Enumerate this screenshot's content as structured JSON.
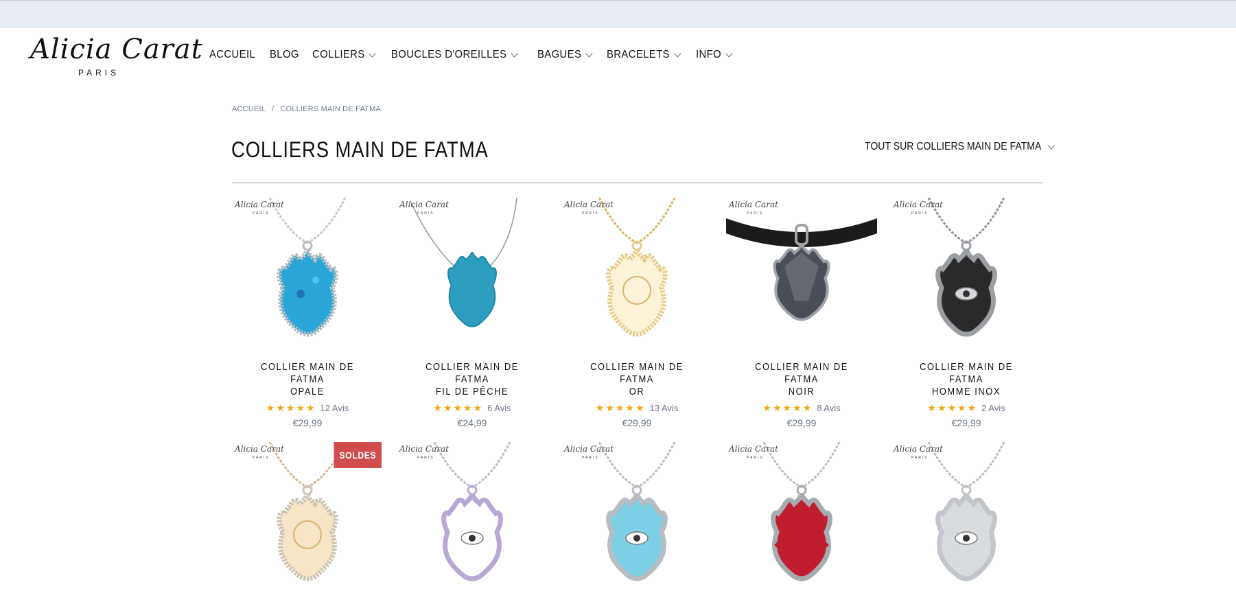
{
  "brand": {
    "name": "Alicia Carat",
    "city": "PARIS"
  },
  "nav": [
    {
      "label": "ACCUEIL",
      "has_dropdown": false
    },
    {
      "label": "BLOG",
      "has_dropdown": false
    },
    {
      "label": "COLLIERS",
      "has_dropdown": true
    },
    {
      "label": "BOUCLES D'OREILLES",
      "has_dropdown": true
    },
    {
      "label": "BAGUES",
      "has_dropdown": true
    },
    {
      "label": "BRACELETS",
      "has_dropdown": true
    },
    {
      "label": "INFO",
      "has_dropdown": true
    }
  ],
  "breadcrumb": {
    "home": "ACCUEIL",
    "separator": "/",
    "current": "COLLIERS MAIN DE FATMA"
  },
  "page": {
    "title": "COLLIERS MAIN DE FATMA",
    "sort_label": "TOUT SUR COLLIERS MAIN DE FATMA"
  },
  "products": [
    {
      "title_line1": "COLLIER MAIN DE FATMA",
      "title_line2": "OPALE",
      "rating": "★★★★★",
      "reviews": "12 Avis",
      "price": "€29,99",
      "chain": "#c5c8cc",
      "metal": "#b9bdc2",
      "fill": "#2aa6d6",
      "style": "opal"
    },
    {
      "title_line1": "COLLIER MAIN DE FATMA",
      "title_line2": "FIL DE PÊCHE",
      "rating": "★★★★★",
      "reviews": "6 Avis",
      "price": "€24,99",
      "chain": "#9aa0a6",
      "metal": "#1f86a8",
      "fill": "#2d9ec0",
      "style": "wire"
    },
    {
      "title_line1": "COLLIER MAIN DE FATMA",
      "title_line2": "OR",
      "rating": "★★★★★",
      "reviews": "13 Avis",
      "price": "€29,99",
      "chain": "#d9b36a",
      "metal": "#e8cc8a",
      "fill": "#fbf2d8",
      "style": "filigree"
    },
    {
      "title_line1": "COLLIER MAIN DE FATMA",
      "title_line2": "NOIR",
      "rating": "★★★★★",
      "reviews": "8 Avis",
      "price": "€29,99",
      "chain": "#1b1b1b",
      "metal": "#9ea3a8",
      "fill": "#4a4f57",
      "style": "cord"
    },
    {
      "title_line1": "COLLIER MAIN DE FATMA",
      "title_line2": "HOMME INOX",
      "rating": "★★★★★",
      "reviews": "2 Avis",
      "price": "€29,99",
      "chain": "#8f9398",
      "metal": "#9a9ea2",
      "fill": "#2a2a2a",
      "style": "engraved"
    },
    {
      "badge": "SOLDES",
      "chain": "#d9b68a",
      "metal": "#c9c2b6",
      "fill": "#f7e6c6",
      "style": "rose"
    },
    {
      "chain": "#b8bcc1",
      "metal": "#b7a8d6",
      "fill": "#ffffff",
      "style": "lilac"
    },
    {
      "chain": "#b8bcc1",
      "metal": "#b7bdc3",
      "fill": "#7ed0e6",
      "style": "blue"
    },
    {
      "chain": "#b8bcc1",
      "metal": "#a7acb1",
      "fill": "#c01e2e",
      "style": "red"
    },
    {
      "chain": "#b8bcc1",
      "metal": "#c2c6ca",
      "fill": "#d9dcdf",
      "style": "silver"
    }
  ]
}
